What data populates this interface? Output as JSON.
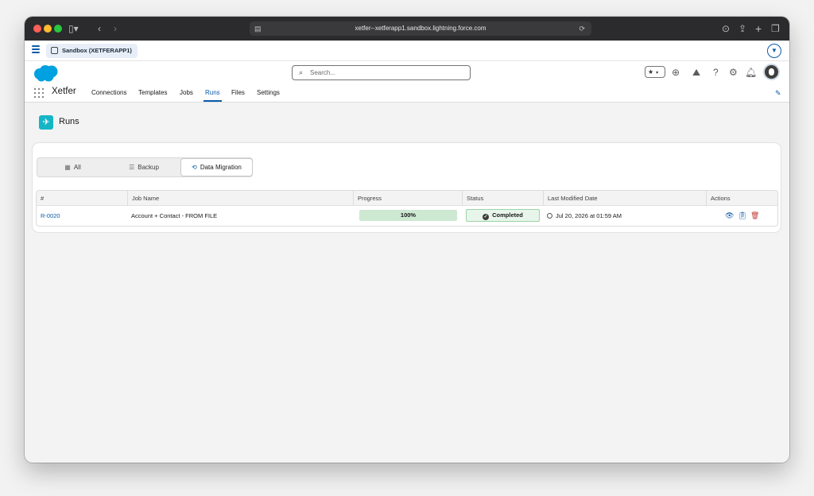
{
  "browser": {
    "url": "xetfer--xetferapp1.sandbox.lightning.force.com"
  },
  "sandbox": {
    "label": "Sandbox (XETFERAPP1)"
  },
  "header": {
    "search_placeholder": "Search...",
    "app_name": "Xetfer",
    "tabs": [
      {
        "label": "Connections"
      },
      {
        "label": "Templates"
      },
      {
        "label": "Jobs"
      },
      {
        "label": "Runs",
        "active": true
      },
      {
        "label": "Files"
      },
      {
        "label": "Settings"
      }
    ]
  },
  "page": {
    "title": "Runs"
  },
  "filters": {
    "all": "All",
    "backup": "Backup",
    "data_migration": "Data Migration",
    "active": "Data Migration"
  },
  "table": {
    "columns": [
      "#",
      "Job Name",
      "Progress",
      "Status",
      "Last Modified Date",
      "Actions"
    ],
    "rows": [
      {
        "id": "R-0020",
        "job_name": "Account + Contact - FROM FILE",
        "progress": "100%",
        "progress_value": 1.0,
        "status": "Completed",
        "last_modified": "Jul 20, 2026 at 01:59 AM"
      }
    ]
  },
  "colors": {
    "brand_blue": "#0b5cab",
    "salesforce_cloud": "#00a1e0",
    "runs_icon": "#16b5c6",
    "success_bg": "#e8f5ea",
    "delete_red": "#c23934"
  },
  "icons": {
    "row_actions": [
      "view-eye-icon",
      "clipboard-icon",
      "trash-icon"
    ]
  }
}
